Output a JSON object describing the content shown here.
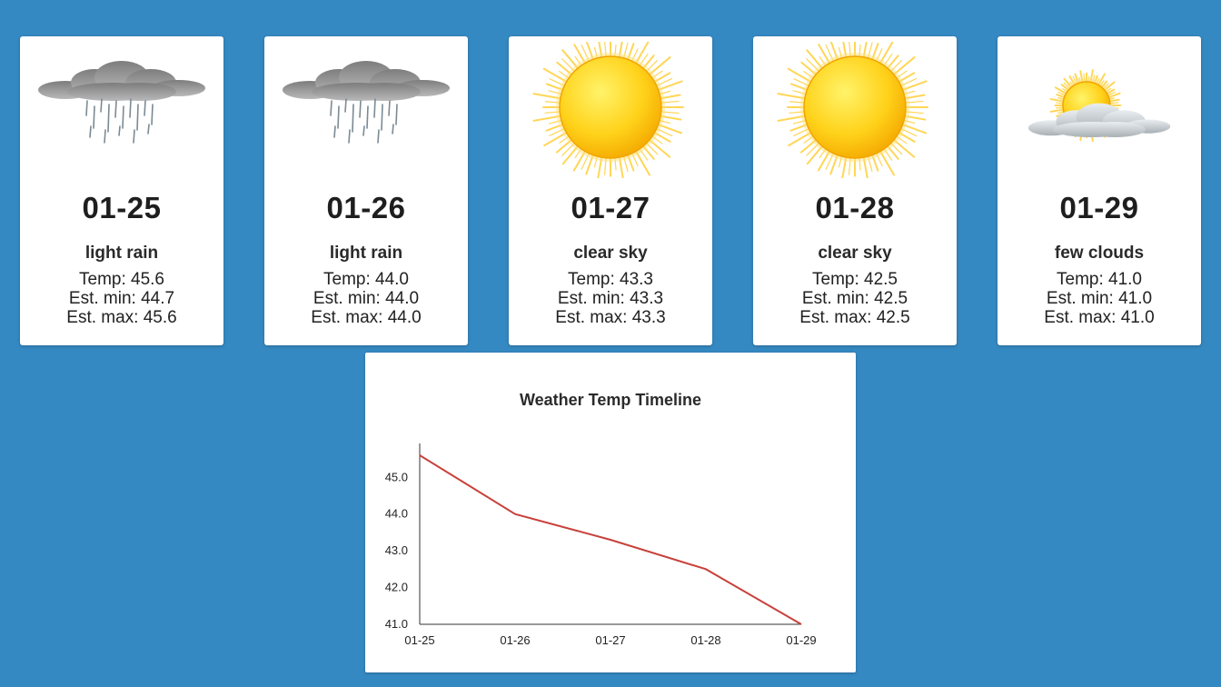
{
  "forecast": [
    {
      "icon": "rain-cloud-icon",
      "date": "01-25",
      "description": "light rain",
      "temp": "Temp: 45.6",
      "min": "Est. min: 44.7",
      "max": "Est. max: 45.6"
    },
    {
      "icon": "rain-cloud-icon",
      "date": "01-26",
      "description": "light rain",
      "temp": "Temp: 44.0",
      "min": "Est. min: 44.0",
      "max": "Est. max: 44.0"
    },
    {
      "icon": "sun-icon",
      "date": "01-27",
      "description": "clear sky",
      "temp": "Temp: 43.3",
      "min": "Est. min: 43.3",
      "max": "Est. max: 43.3"
    },
    {
      "icon": "sun-icon",
      "date": "01-28",
      "description": "clear sky",
      "temp": "Temp: 42.5",
      "min": "Est. min: 42.5",
      "max": "Est. max: 42.5"
    },
    {
      "icon": "sun-behind-clouds-icon",
      "date": "01-29",
      "description": "few clouds",
      "temp": "Temp: 41.0",
      "min": "Est. min: 41.0",
      "max": "Est. max: 41.0"
    }
  ],
  "colors": {
    "background": "#3589c2",
    "card": "#ffffff",
    "line": "#c8413b"
  },
  "chart_data": {
    "type": "line",
    "title": "Weather Temp Timeline",
    "xlabel": "",
    "ylabel": "",
    "categories": [
      "01-25",
      "01-26",
      "01-27",
      "01-28",
      "01-29"
    ],
    "series": [
      {
        "values": [
          45.6,
          44.0,
          43.3,
          42.5,
          41.0
        ]
      }
    ],
    "ylim": [
      41.0,
      45.6
    ],
    "yticks": [
      "41.0",
      "42.0",
      "43.0",
      "44.0",
      "45.0"
    ],
    "grid": false
  }
}
